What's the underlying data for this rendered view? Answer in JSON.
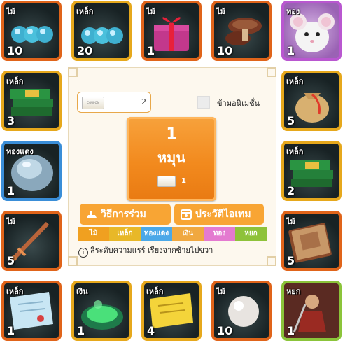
{
  "tiles": [
    {
      "tier": "ไม้",
      "count": "10",
      "icon": "blue-pearls-icon"
    },
    {
      "tier": "เหล็ก",
      "count": "20",
      "icon": "blue-pearls-icon"
    },
    {
      "tier": "ไม้",
      "count": "1",
      "icon": "gift-box-icon"
    },
    {
      "tier": "ไม้",
      "count": "10",
      "icon": "mushroom-icon"
    },
    {
      "tier": "ทอง",
      "count": "1",
      "icon": "white-mouse-icon"
    },
    {
      "tier": "เหล็ก",
      "count": "3",
      "icon": "green-books-icon"
    },
    {
      "tier": "เหล็ก",
      "count": "5",
      "icon": "money-sack-icon"
    },
    {
      "tier": "ทองแดง",
      "count": "1",
      "icon": "silver-orb-icon"
    },
    {
      "tier": "เหล็ก",
      "count": "2",
      "icon": "green-books-icon"
    },
    {
      "tier": "ไม้",
      "count": "5",
      "icon": "bronze-sword-icon"
    },
    {
      "tier": "ไม้",
      "count": "5",
      "icon": "old-book-icon"
    },
    {
      "tier": "เหล็ก",
      "count": "1",
      "icon": "blue-scroll-icon"
    },
    {
      "tier": "เงิน",
      "count": "1",
      "icon": "green-potion-icon"
    },
    {
      "tier": "เหล็ก",
      "count": "4",
      "icon": "yellow-scroll-icon"
    },
    {
      "tier": "ไม้",
      "count": "10",
      "icon": "pearl-icon"
    },
    {
      "tier": "หยก",
      "count": "1",
      "icon": "warrior-card-icon"
    }
  ],
  "panel": {
    "coupon_label": "COUPON",
    "coupon_count": "2",
    "skip_animation": "ข้ามอนิเมชั่น",
    "spin_number": "1",
    "spin_label": "หมุน",
    "spin_cost": "1",
    "how_to_label": "วิธีการร่วม",
    "history_label": "ประวัติไอเทม",
    "rarity": [
      "ไม้",
      "เหล็ก",
      "ทองแดง",
      "เงิน",
      "ทอง",
      "หยก"
    ],
    "rarity_note": "สีระดับความแรร์ เรียงจากซ้ายไปขวา"
  },
  "colors": {
    "wood": "#e0641a",
    "iron": "#e6a81c",
    "bronze": "#3a8ed8",
    "silver": "#e6a81c",
    "gold": "#b957d0",
    "jade": "#8bc43a",
    "rarity_bar": [
      "#f0a020",
      "#e8b828",
      "#4aa8e8",
      "#f0a840",
      "#e47ad0",
      "#8ec23a"
    ]
  }
}
